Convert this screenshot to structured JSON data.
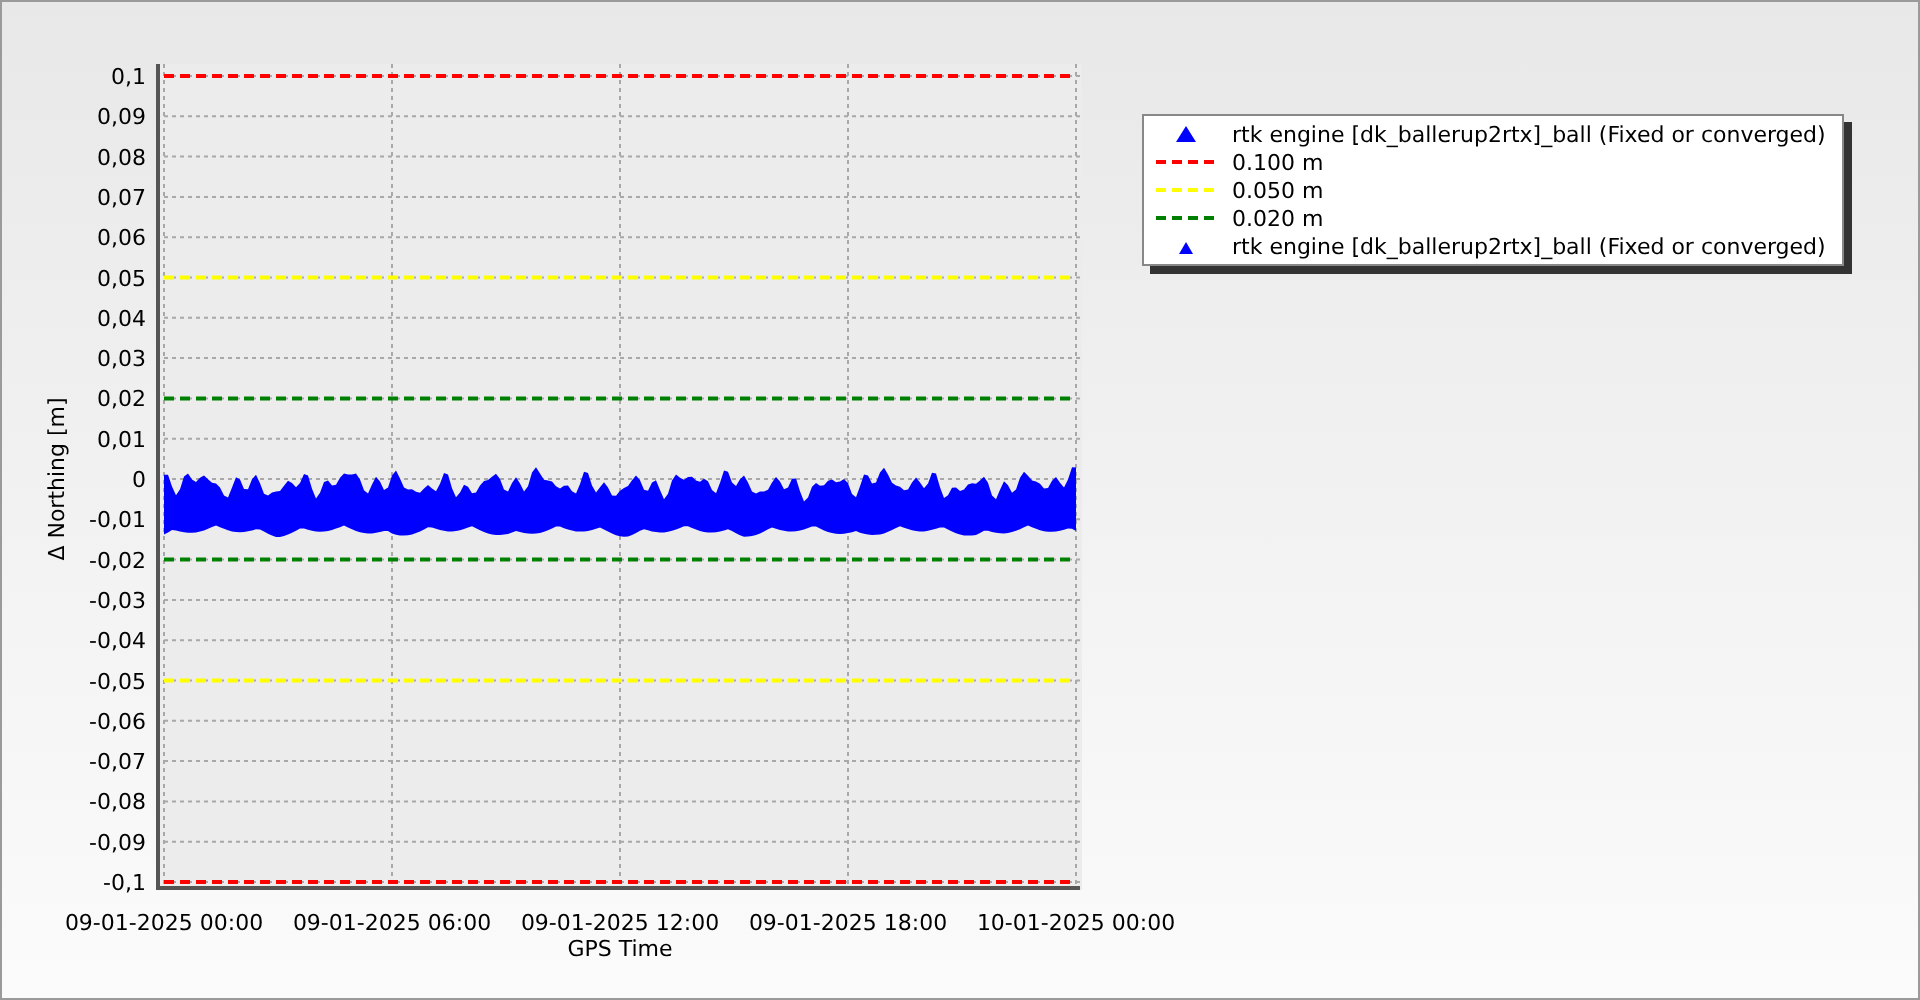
{
  "chart": {
    "chart_data": {
      "type": "line",
      "grid": true,
      "xlabel": "GPS Time",
      "ylabel": "Δ Northing [m]",
      "ylim": [
        -0.1,
        0.1
      ],
      "categories": [
        "09-01-2025 00:00",
        "09-01-2025 06:00",
        "09-01-2025 12:00",
        "09-01-2025 18:00",
        "10-01-2025 00:00"
      ],
      "yticks": [
        {
          "value": 0.1,
          "label": "0,1"
        },
        {
          "value": 0.09,
          "label": "0,09"
        },
        {
          "value": 0.08,
          "label": "0,08"
        },
        {
          "value": 0.07,
          "label": "0,07"
        },
        {
          "value": 0.06,
          "label": "0,06"
        },
        {
          "value": 0.05,
          "label": "0,05"
        },
        {
          "value": 0.04,
          "label": "0,04"
        },
        {
          "value": 0.03,
          "label": "0,03"
        },
        {
          "value": 0.02,
          "label": "0,02"
        },
        {
          "value": 0.01,
          "label": "0,01"
        },
        {
          "value": 0,
          "label": "0"
        },
        {
          "value": -0.01,
          "label": "-0,01"
        },
        {
          "value": -0.02,
          "label": "-0,02"
        },
        {
          "value": -0.03,
          "label": "-0,03"
        },
        {
          "value": -0.04,
          "label": "-0,04"
        },
        {
          "value": -0.05,
          "label": "-0,05"
        },
        {
          "value": -0.06,
          "label": "-0,06"
        },
        {
          "value": -0.07,
          "label": "-0,07"
        },
        {
          "value": -0.08,
          "label": "-0,08"
        },
        {
          "value": -0.09,
          "label": "-0,09"
        },
        {
          "value": -0.1,
          "label": "-0,1"
        }
      ],
      "series": [
        {
          "color": "#ff0000",
          "line_style": "dashed",
          "values": [
            0.1,
            0.1,
            0.1,
            0.1,
            0.1
          ]
        },
        {
          "color": "#ff0000",
          "line_style": "dashed",
          "values": [
            -0.1,
            -0.1,
            -0.1,
            -0.1,
            -0.1
          ]
        },
        {
          "color": "#ffff00",
          "line_style": "dashed",
          "values": [
            0.05,
            0.05,
            0.05,
            0.05,
            0.05
          ]
        },
        {
          "color": "#ffff00",
          "line_style": "dashed",
          "values": [
            -0.05,
            -0.05,
            -0.05,
            -0.05,
            -0.05
          ]
        },
        {
          "color": "#008000",
          "line_style": "dashed",
          "values": [
            0.02,
            0.02,
            0.02,
            0.02,
            0.02
          ]
        },
        {
          "color": "#008000",
          "line_style": "dashed",
          "values": [
            -0.02,
            -0.02,
            -0.02,
            -0.02,
            -0.02
          ]
        }
      ]
    }
  },
  "legend": [
    {
      "kind": "marker",
      "label": "rtk engine [dk_ballerup2rtx]_ball (Fixed or converged)",
      "color": "#0000ff"
    },
    {
      "kind": "line",
      "label": "0.100 m",
      "color": "#ff0000"
    },
    {
      "kind": "line",
      "label": "0.050 m",
      "color": "#ffff00"
    },
    {
      "kind": "line",
      "label": "0.020 m",
      "color": "#008000"
    },
    {
      "kind": "small-marker",
      "label": "rtk engine [dk_ballerup2rtx]_ball (Fixed or converged)",
      "color": "#0000ff"
    }
  ]
}
